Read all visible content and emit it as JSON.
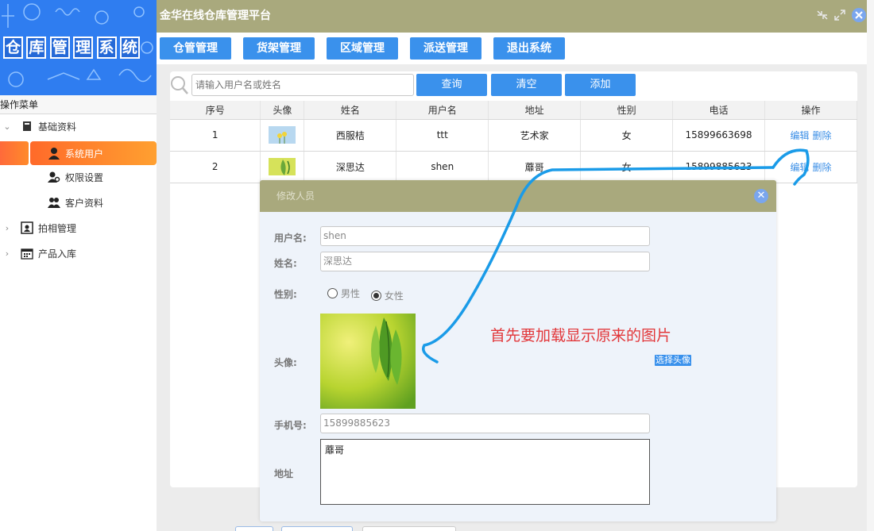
{
  "logo": {
    "chars": [
      "仓",
      "库",
      "管",
      "理",
      "系",
      "统"
    ]
  },
  "menu_title": "操作菜单",
  "sidebar": {
    "items": [
      {
        "label": "基础资料",
        "icon": "book-icon",
        "expanded": true
      },
      {
        "label": "系统用户",
        "icon": "user-icon",
        "active": true
      },
      {
        "label": "权限设置",
        "icon": "user-key-icon"
      },
      {
        "label": "客户资料",
        "icon": "users-icon"
      },
      {
        "label": "拍相管理",
        "icon": "photo-frame-icon"
      },
      {
        "label": "产品入库",
        "icon": "calendar-icon"
      }
    ]
  },
  "header": {
    "title": "金华在线仓库管理平台"
  },
  "nav": {
    "buttons": [
      "仓管管理",
      "货架管理",
      "区域管理",
      "派送管理",
      "退出系统"
    ]
  },
  "search": {
    "placeholder": "请输入用户名或姓名",
    "query_label": "查询",
    "clear_label": "清空",
    "add_label": "添加"
  },
  "table": {
    "headers": [
      "序号",
      "头像",
      "姓名",
      "用户名",
      "地址",
      "性别",
      "电话",
      "操作"
    ],
    "rows": [
      {
        "no": "1",
        "name": "西服桔",
        "username": "ttt",
        "address": "艺术家",
        "gender": "女",
        "phone": "15899663698",
        "edit": "编辑",
        "delete": "删除"
      },
      {
        "no": "2",
        "name": "深思达",
        "username": "shen",
        "address": "蘼哥",
        "gender": "女",
        "phone": "15899885623",
        "edit": "编辑",
        "delete": "删除"
      }
    ]
  },
  "dialog": {
    "title": "修改人员",
    "username_label": "用户名:",
    "username": "shen",
    "name_label": "姓名:",
    "name": "深思达",
    "gender_label": "性别:",
    "gender_male": "男性",
    "gender_female": "女性",
    "gender_selected": "女性",
    "avatar_label": "头像:",
    "choose_avatar": "选择头像",
    "phone_label": "手机号:",
    "phone": "15899885623",
    "address_label": "地址",
    "address": "蘼哥"
  },
  "annotation": {
    "note": "首先要加载显示原来的图片",
    "arrow_color": "#1a9be8"
  },
  "colors": {
    "header": "#a9a97d",
    "button": "#3a91ec",
    "active_menu": "#ff7a2a",
    "note": "#e2373a"
  }
}
